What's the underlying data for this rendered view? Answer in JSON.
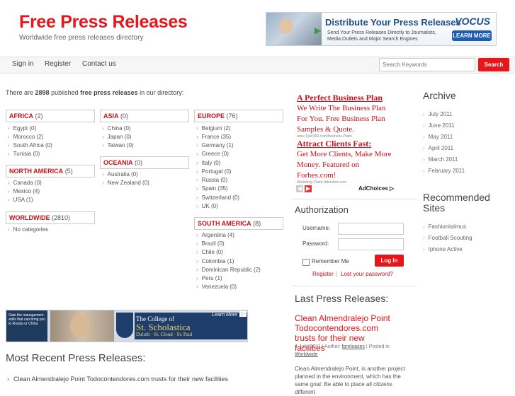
{
  "site": {
    "title": "Free Press Releases",
    "tagline": "Worldwide free press releases directory"
  },
  "top_banner": {
    "headline": "Distribute Your Press Releases",
    "subtext_1": "Send Your Press Releases Directly to Journalists,",
    "subtext_2": "Media Outlets and Major Search Engines",
    "brand": "VOCUS",
    "cta": "LEARN MORE"
  },
  "nav": {
    "items": [
      "Sign in",
      "Register",
      "Contact us"
    ]
  },
  "search": {
    "placeholder": "Search Keywords",
    "button": "Search"
  },
  "directory": {
    "intro_prefix": "There are ",
    "count": "2898",
    "intro_mid": " published ",
    "intro_bold": "free press releases",
    "intro_suffix": " in our directory:",
    "regions": [
      {
        "name": "AFRICA",
        "count": "(2)",
        "countries": [
          "Egypt (0)",
          "Morocco (2)",
          "South Africa (0)",
          "Tunisia (0)"
        ]
      },
      {
        "name": "NORTH AMERICA",
        "count": "(5)",
        "countries": [
          "Canada (0)",
          "Mexico (4)",
          "USA (1)"
        ]
      },
      {
        "name": "WORLDWIDE",
        "count": "(2810)",
        "countries": [
          "No categories"
        ]
      },
      {
        "name": "ASIA",
        "count": "(0)",
        "countries": [
          "China (0)",
          "Japan (0)",
          "Taiwan (0)"
        ]
      },
      {
        "name": "OCEANIA",
        "count": "(0)",
        "countries": [
          "Australia (0)",
          "New Zealand (0)"
        ]
      },
      {
        "name": "EUROPE",
        "count": "(76)",
        "countries": [
          "Belgium (2)",
          "France (35)",
          "Germany (1)",
          "Greece (0)",
          "Italy (0)",
          "Portugal (0)",
          "Russia (0)",
          "Spain (35)",
          "Switzerland (0)",
          "UK (0)"
        ]
      },
      {
        "name": "SOUTH AMERICA",
        "count": "(8)",
        "countries": [
          "Argentina (4)",
          "Brazil (0)",
          "Chile (0)",
          "Colombia (1)",
          "Dominican Republic (2)",
          "Peru (1)",
          "Venezuela (0)"
        ]
      }
    ]
  },
  "ads": [
    {
      "title": "A Perfect Business Plan",
      "text": "We Write The Business Plan For You. Free Business Plan Samples & Quote.",
      "url": "www.Tyler360.com/Business-Plans"
    },
    {
      "title": "Attract Clients Fast:",
      "text": "Get More Clients, Make More Money. Featured on Forbes.com!",
      "url": "Marketing-Client-Attraction.com"
    }
  ],
  "adchoices": "AdChoices ▷",
  "auth": {
    "heading": "Authorization",
    "username_label": "Username:",
    "password_label": "Password:",
    "remember_label": "Remember Me",
    "login_button": "Log In",
    "register_link": "Register",
    "separator": "|",
    "lost_password_link": "Lost your password?"
  },
  "last_press": {
    "heading": "Last Press Releases:",
    "title": "Clean Almendralejo Point Todocontendores.com trusts for their new facilities",
    "date": "4 July, 2011",
    "author_prefix": "Author:",
    "author": "fpreleases",
    "posted_prefix": "Posted in",
    "category": "Worldwide",
    "body": "Clean Almendralejo Point, is another project planned in the environment, which has the same goal: Be able to place all citizens different"
  },
  "archive": {
    "heading": "Archive",
    "items": [
      "July 2011",
      "June 2011",
      "May 2011",
      "April 2011",
      "March 2011",
      "February 2011"
    ]
  },
  "recommended": {
    "heading": "Recommended Sites",
    "items": [
      "Fashionistimus",
      "Football Scouting",
      "Iphone Active"
    ]
  },
  "bottom_banner": {
    "left_text": "Gain the management skills that can bring you to Russia or China",
    "school_line1": "The College of",
    "school_line2": "St. Scholastica",
    "school_line3": "Duluth · St. Cloud · St. Paul",
    "learn_more": "Learn More"
  },
  "most_recent": {
    "heading": "Most Recent Press Releases:",
    "items": [
      "Clean Almendralejo Point Todocontendores.com trusts for their new facilities"
    ]
  },
  "colors": {
    "brand_red": "#e8151a",
    "ad_red": "#c8101a",
    "text_gray": "#555555"
  }
}
